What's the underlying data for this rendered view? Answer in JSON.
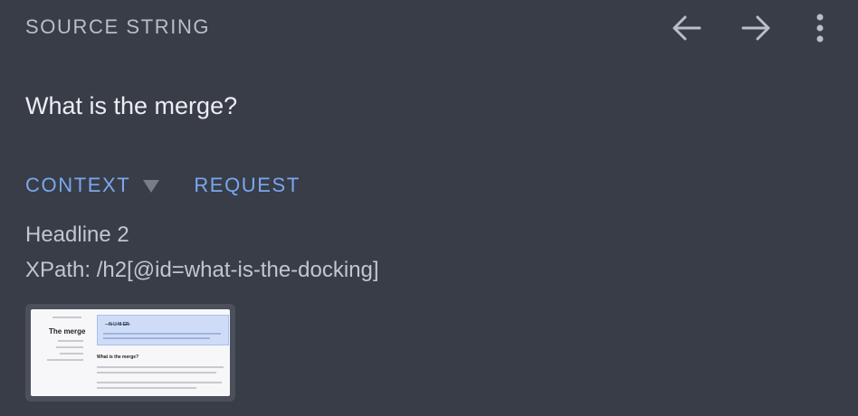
{
  "header": {
    "title": "SOURCE STRING",
    "actions": {
      "back_icon": "arrow-left-icon",
      "forward_icon": "arrow-right-icon",
      "more_icon": "more-vertical-icon"
    }
  },
  "source": {
    "text": "What is the merge?"
  },
  "tabs": {
    "context_label": "CONTEXT",
    "request_label": "REQUEST"
  },
  "context": {
    "element_type": "Headline 2",
    "xpath": "XPath: /h2[@id=what-is-the-docking]"
  },
  "thumbnail": {
    "heading": "The merge",
    "box_title": "– ̶N̶ U̶ M̶ E̶R̶",
    "subheading": "What is the merge?"
  },
  "colors": {
    "background": "#383d48",
    "header_text": "#b9bec8",
    "accent": "#7ba7ef",
    "body_text": "#c2c6ce"
  }
}
